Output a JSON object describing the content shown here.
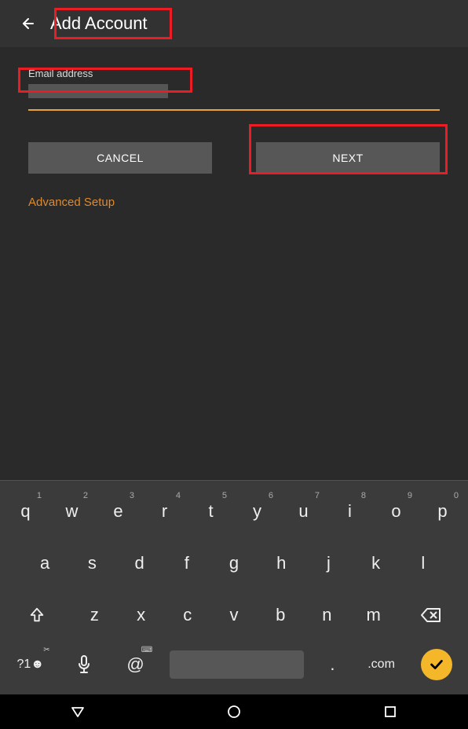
{
  "header": {
    "title": "Add Account"
  },
  "form": {
    "email_label": "Email address",
    "email_value": "",
    "cancel_label": "CANCEL",
    "next_label": "NEXT",
    "advanced_label": "Advanced Setup"
  },
  "keyboard": {
    "row1": [
      {
        "main": "q",
        "sup": "1"
      },
      {
        "main": "w",
        "sup": "2"
      },
      {
        "main": "e",
        "sup": "3"
      },
      {
        "main": "r",
        "sup": "4"
      },
      {
        "main": "t",
        "sup": "5"
      },
      {
        "main": "y",
        "sup": "6"
      },
      {
        "main": "u",
        "sup": "7"
      },
      {
        "main": "i",
        "sup": "8"
      },
      {
        "main": "o",
        "sup": "9"
      },
      {
        "main": "p",
        "sup": "0"
      }
    ],
    "row2": [
      "a",
      "s",
      "d",
      "f",
      "g",
      "h",
      "j",
      "k",
      "l"
    ],
    "row3": [
      "z",
      "x",
      "c",
      "v",
      "b",
      "n",
      "m"
    ],
    "sym_label": "?1☻",
    "at_label": "@",
    "period_label": ".",
    "dotcom_label": ".com"
  }
}
